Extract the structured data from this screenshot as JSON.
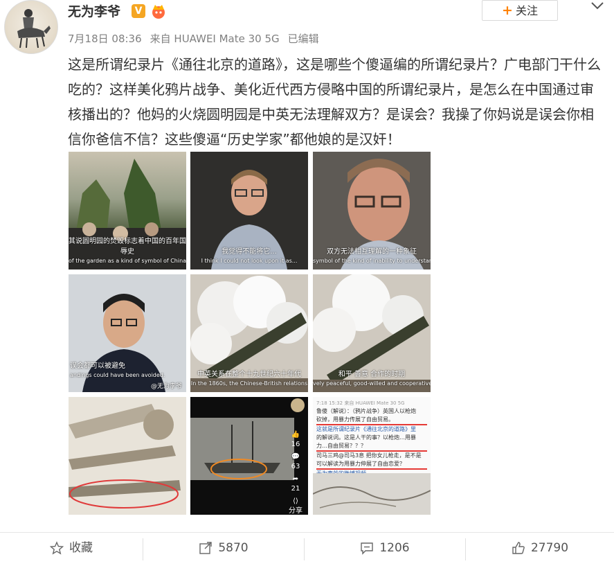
{
  "user": {
    "name": "无为李爷",
    "verified_badge": "V",
    "date": "7月18日 08:36",
    "source": "来自 HUAWEI Mate 30 5G",
    "edited": "已编辑"
  },
  "follow": {
    "plus": "+",
    "label": "关注"
  },
  "post": {
    "text": "这是所谓纪录片《通往北京的道路》，这是哪些个傻逼编的所谓纪录片？广电部门干什么吃的？这样美化鸦片战争、美化近代西方侵略中国的所谓纪录片，是怎么在中国通过审核播出的？他妈的火烧圆明园是中英无法理解双方？是误会？我操了你妈说是误会你相信你爸信不信？这些傻逼“历史学家”都他娘的是汉奸！"
  },
  "images": [
    {
      "cap_cn": "其说圆明园的焚毁标志着中国的百年国辱史",
      "cap_en": "of the garden as a kind of symbol of China century of humiliation",
      "wm": ""
    },
    {
      "cap_cn": "我觉得不能将它...",
      "cap_en": "I think I could not look upon it as...",
      "wm": ""
    },
    {
      "cap_cn": "双方无法相互理解的一种象征",
      "cap_en": "symbol of the kind of inability to understand each other",
      "wm": ""
    },
    {
      "cap_cn": "误会都可以被避免",
      "cap_en": "andings could have been avoided.",
      "wm": "@无为李爷"
    },
    {
      "cap_cn": "中英关系在整个十九世纪六十年代",
      "cap_en": "In the 1860s, the Chinese-British relations",
      "wm": ""
    },
    {
      "cap_cn": "和平 善意 合作的时期",
      "cap_en": "vely peaceful, good-willed and cooperative.",
      "wm": ""
    },
    {
      "cap_cn": "",
      "cap_en": "",
      "wm": ""
    },
    {
      "cap_cn": "",
      "cap_en": "",
      "wm": ""
    },
    {
      "cap_cn": "",
      "cap_en": "",
      "wm": ""
    }
  ],
  "thumb8": {
    "likes": "16",
    "comments": "63",
    "shares": "21",
    "share_label": "分享"
  },
  "thumb9": {
    "header": "7:18 15:32  来自 HUAWEI Mate 30 5G",
    "line1": "鲁傻（解说）：（鸦片战争）英国人以枪炮",
    "line2": "砍掉，用暴力传展了自由贸易。",
    "line3": "这就是所谓纪录片《通往北京的道路》里",
    "line4": "的解说词。这是人干的事？以枪炮…用暴",
    "line5": "力…自由贸易？？？",
    "line6": "司马三鸡@司马3息 把你女儿枪走，是不是",
    "line7": "可以解读为用暴力伸展了自由恋爱？",
    "line8": "无为李爷的微博视频"
  },
  "actions": {
    "favorite": "收藏",
    "repost": "5870",
    "comment": "1206",
    "like": "27790"
  },
  "colors": {
    "accent": "#ff8200",
    "badge": "#f5a623",
    "text": "#333333",
    "meta": "#808080"
  }
}
